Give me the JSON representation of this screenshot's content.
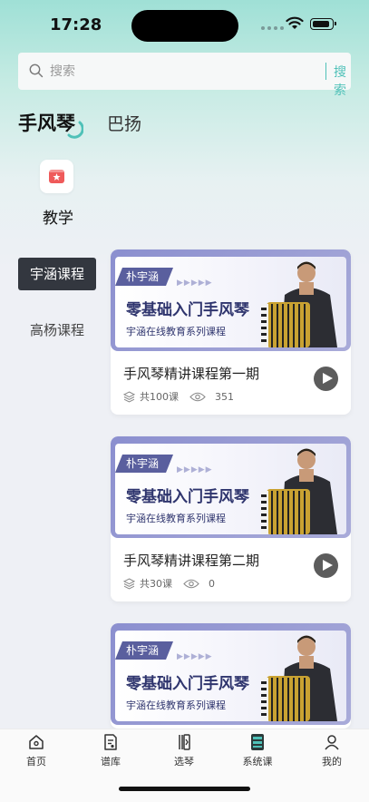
{
  "status_bar": {
    "time": "17:28"
  },
  "search": {
    "placeholder": "搜索",
    "button_label": "搜索"
  },
  "category_tabs": [
    {
      "label": "手风琴",
      "active": true
    },
    {
      "label": "巴扬",
      "active": false
    }
  ],
  "teaching": {
    "icon": "star-badge-icon",
    "label": "教学"
  },
  "side_menu": [
    {
      "label": "宇涵课程",
      "active": true
    },
    {
      "label": "高杨课程",
      "active": false
    }
  ],
  "courses": [
    {
      "banner": {
        "tag": "朴宇涵",
        "title": "零基础入门手风琴",
        "subtitle": "宇涵在线教育系列课程"
      },
      "title": "手风琴精讲课程第一期",
      "lessons": "共100课",
      "views": "351"
    },
    {
      "banner": {
        "tag": "朴宇涵",
        "title": "零基础入门手风琴",
        "subtitle": "宇涵在线教育系列课程"
      },
      "title": "手风琴精讲课程第二期",
      "lessons": "共30课",
      "views": "0"
    },
    {
      "banner": {
        "tag": "朴宇涵",
        "title": "零基础入门手风琴",
        "subtitle": "宇涵在线教育系列课程"
      }
    }
  ],
  "bottom_nav": [
    {
      "label": "首页",
      "icon": "home-icon",
      "active": false
    },
    {
      "label": "谱库",
      "icon": "score-library-icon",
      "active": false
    },
    {
      "label": "选琴",
      "icon": "piano-select-icon",
      "active": false
    },
    {
      "label": "系统课",
      "icon": "system-course-icon",
      "active": true
    },
    {
      "label": "我的",
      "icon": "profile-icon",
      "active": false
    }
  ],
  "colors": {
    "accent": "#4fc1b8",
    "active_side_bg": "#33373f",
    "banner_frame": "#8b8fcf",
    "banner_text": "#2f356e"
  }
}
